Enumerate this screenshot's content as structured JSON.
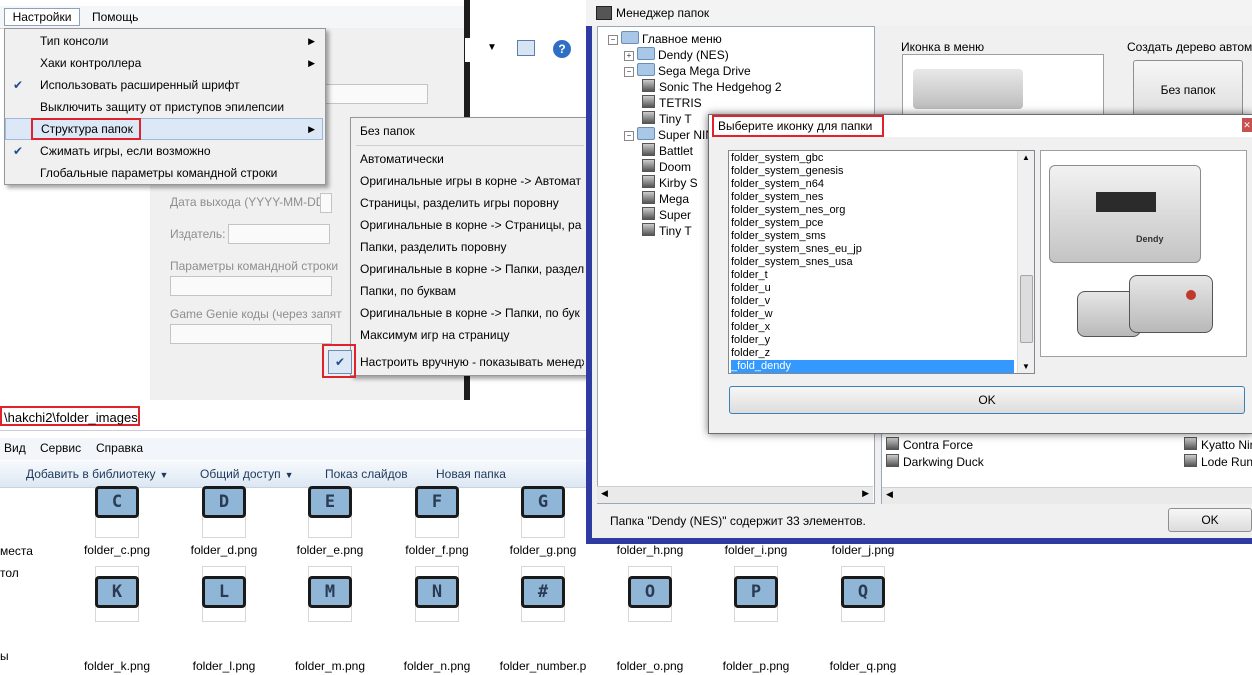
{
  "settings": {
    "menubar": [
      "Настройки",
      "Помощь"
    ],
    "menu": [
      {
        "label": "Тип консоли",
        "arrow": "▶",
        "check": ""
      },
      {
        "label": "Хаки контроллера",
        "arrow": "▶",
        "check": ""
      },
      {
        "label": "Использовать расширенный шрифт",
        "arrow": "",
        "check": "✔"
      },
      {
        "label": "Выключить защиту от приступов эпилепсии",
        "arrow": "",
        "check": ""
      },
      {
        "label": "Структура папок",
        "arrow": "▶",
        "check": ""
      },
      {
        "label": "Сжимать игры, если возможно",
        "arrow": "",
        "check": "✔"
      },
      {
        "label": "Глобальные параметры командной строки",
        "arrow": "",
        "check": ""
      }
    ],
    "submenu": [
      "Без папок",
      "Автоматически",
      "Оригинальные игры в корне -> Автомат",
      "Страницы, разделить игры поровну",
      "Оригинальные в корне -> Страницы, ра",
      "Папки, разделить поровну",
      "Оригинальные в корне -> Папки, раздел",
      "Папки, по буквам",
      "Оригинальные в корне -> Папки, по бук",
      "Максимум игр на страницу",
      "Настроить вручную - показывать менедж"
    ],
    "check_mark": "✔",
    "form": {
      "release_date": "Дата выхода (YYYY-MM-DD):",
      "publisher": "Издатель:",
      "cmdline": "Параметры командной строки",
      "genie": "Game Genie коды (через запят"
    }
  },
  "explorer": {
    "address": "\\hakchi2\\folder_images",
    "menubar": [
      "Вид",
      "Сервис",
      "Справка"
    ],
    "commands": [
      "Добавить в библиотеку",
      "Общий доступ",
      "Показ слайдов",
      "Новая папка"
    ],
    "nav_items": [
      "места",
      "тол",
      "ы"
    ],
    "row1": [
      {
        "letter": "C",
        "name": "folder_c.png"
      },
      {
        "letter": "D",
        "name": "folder_d.png"
      },
      {
        "letter": "E",
        "name": "folder_e.png"
      },
      {
        "letter": "F",
        "name": "folder_f.png"
      },
      {
        "letter": "G",
        "name": "folder_g.png"
      },
      {
        "letter": "",
        "name": "folder_h.png"
      },
      {
        "letter": "",
        "name": "folder_i.png"
      },
      {
        "letter": "",
        "name": "folder_j.png"
      }
    ],
    "row2": [
      {
        "letter": "K",
        "name": "folder_k.png"
      },
      {
        "letter": "L",
        "name": "folder_l.png"
      },
      {
        "letter": "M",
        "name": "folder_m.png"
      },
      {
        "letter": "N",
        "name": "folder_n.png"
      },
      {
        "letter": "#",
        "name": "folder_number.p"
      },
      {
        "letter": "O",
        "name": "folder_o.png"
      },
      {
        "letter": "P",
        "name": "folder_p.png"
      },
      {
        "letter": "Q",
        "name": "folder_q.png"
      }
    ]
  },
  "folder_manager": {
    "title": "Менеджер папок",
    "tree": [
      {
        "label": "Главное меню",
        "type": "folder",
        "level": 0,
        "expander": "−"
      },
      {
        "label": "Dendy (NES)",
        "type": "folder",
        "level": 1,
        "expander": "+"
      },
      {
        "label": "Sega Mega Drive",
        "type": "folder",
        "level": 1,
        "expander": "−"
      },
      {
        "label": "Sonic The Hedgehog 2",
        "type": "game",
        "level": 2,
        "expander": ""
      },
      {
        "label": "TETRIS",
        "type": "game",
        "level": 2,
        "expander": ""
      },
      {
        "label": "Tiny T",
        "type": "game",
        "level": 2,
        "expander": ""
      },
      {
        "label": "Super NIN",
        "type": "folder",
        "level": 1,
        "expander": "−"
      },
      {
        "label": "Battlet",
        "type": "game",
        "level": 2,
        "expander": ""
      },
      {
        "label": "Doom",
        "type": "game",
        "level": 2,
        "expander": ""
      },
      {
        "label": "Kirby S",
        "type": "game",
        "level": 2,
        "expander": ""
      },
      {
        "label": "Mega",
        "type": "game",
        "level": 2,
        "expander": ""
      },
      {
        "label": "Super",
        "type": "game",
        "level": 2,
        "expander": ""
      },
      {
        "label": "Tiny T",
        "type": "game",
        "level": 2,
        "expander": ""
      }
    ],
    "icon_label": "Иконка в меню",
    "create_tree_label": "Создать дерево автомат",
    "no_folders_button": "Без папок",
    "list_items": [
      "Contra Force",
      "Darkwing Duck",
      "Kyatto Nind",
      "Lode Runne"
    ],
    "status": "Папка \"Dendy (NES)\" содержит 33 элементов.",
    "ok_button": "OK"
  },
  "icon_dialog": {
    "title": "Выберите иконку для папки",
    "items": [
      "folder_system_gbc",
      "folder_system_genesis",
      "folder_system_n64",
      "folder_system_nes",
      "folder_system_nes_org",
      "folder_system_pce",
      "folder_system_sms",
      "folder_system_snes_eu_jp",
      "folder_system_snes_usa",
      "folder_t",
      "folder_u",
      "folder_v",
      "folder_w",
      "folder_x",
      "folder_y",
      "folder_z",
      "_fold_dendy"
    ],
    "selected_index": 16,
    "ok_button": "OK",
    "close_glyph": "✕",
    "console_logo": "Dendy"
  },
  "colors": {
    "highlight_red": "#e0222c",
    "selection_blue": "#3399ff",
    "window_border_blue": "#2f3aa3"
  }
}
